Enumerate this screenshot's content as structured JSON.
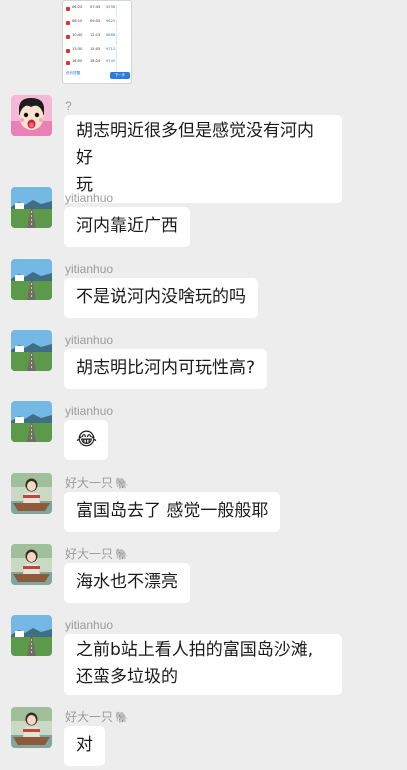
{
  "shared_image": {
    "rows": [
      {
        "dep": "06:20",
        "arr": "07:45",
        "price": "¥598"
      },
      {
        "dep": "08:10",
        "arr": "09:55",
        "price": "¥620"
      },
      {
        "dep": "10:40",
        "arr": "12:15",
        "price": "¥688"
      },
      {
        "dep": "13:30",
        "arr": "15:05",
        "price": "¥712"
      },
      {
        "dep": "16:50",
        "arr": "18:25",
        "price": "¥745"
      }
    ],
    "footer_left": "低价提醒",
    "footer_button": "下一步"
  },
  "messages": [
    {
      "sender": "?",
      "avatar": "cartoon-avatar",
      "lines": [
        "胡志明近很多但是感觉没有河内好",
        "玩"
      ]
    },
    {
      "sender": "yitianhuo",
      "avatar": "road-landscape-avatar",
      "lines": [
        "河内靠近广西"
      ]
    },
    {
      "sender": "yitianhuo",
      "avatar": "road-landscape-avatar",
      "lines": [
        "不是说河内没啥玩的吗"
      ]
    },
    {
      "sender": "yitianhuo",
      "avatar": "road-landscape-avatar",
      "lines": [
        "胡志明比河内可玩性高?"
      ]
    },
    {
      "sender": "yitianhuo",
      "avatar": "road-landscape-avatar",
      "lines": [
        "😂"
      ]
    },
    {
      "sender": "好大一只",
      "sender_icon": "🐘",
      "avatar": "boat-girl-avatar",
      "lines": [
        "富国岛去了 感觉一般般耶"
      ]
    },
    {
      "sender": "好大一只",
      "sender_icon": "🐘",
      "avatar": "boat-girl-avatar",
      "lines": [
        "海水也不漂亮"
      ]
    },
    {
      "sender": "yitianhuo",
      "avatar": "road-landscape-avatar",
      "lines": [
        "之前b站上看人拍的富国岛沙滩,",
        "还蛮多垃圾的"
      ]
    },
    {
      "sender": "好大一只",
      "sender_icon": "🐘",
      "avatar": "boat-girl-avatar",
      "lines": [
        "对"
      ]
    }
  ]
}
